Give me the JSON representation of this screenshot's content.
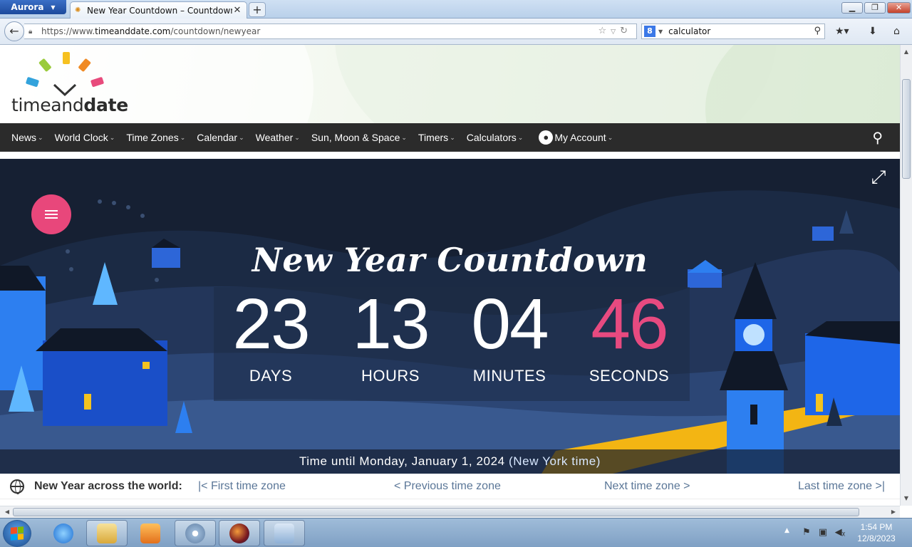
{
  "browser": {
    "app_name": "Aurora",
    "tab_title": "New Year Countdown – Countdown to ...",
    "new_tab_symbol": "+",
    "url_prefix": "https://www.",
    "url_domain": "timeanddate.com",
    "url_path": "/countdown/newyear",
    "search_value": "calculator",
    "search_engine_letter": "8"
  },
  "site": {
    "logo_text_light": "timeand",
    "logo_text_dark": "date",
    "nav": [
      {
        "label": "News"
      },
      {
        "label": "World Clock"
      },
      {
        "label": "Time Zones"
      },
      {
        "label": "Calendar"
      },
      {
        "label": "Weather"
      },
      {
        "label": "Sun, Moon & Space"
      },
      {
        "label": "Timers"
      },
      {
        "label": "Calculators"
      },
      {
        "label": "My Account"
      }
    ]
  },
  "countdown": {
    "title": "New Year Countdown",
    "days": "23",
    "days_label": "DAYS",
    "hours": "13",
    "hours_label": "HOURS",
    "minutes": "04",
    "minutes_label": "MINUTES",
    "seconds": "46",
    "seconds_label": "SECONDS",
    "until_text": "Time until Monday, January 1, 2024 ",
    "until_zone": "(New York time)"
  },
  "world_row": {
    "title": "New Year across the world:",
    "first": "First time zone",
    "previous": "Previous time zone",
    "next": "Next time zone",
    "last": "Last time zone"
  },
  "taskbar": {
    "time": "1:54 PM",
    "date": "12/8/2023"
  },
  "colors": {
    "accent_pink": "#e74a80",
    "nav_bg": "#2b2b2b",
    "hero_bg": "#162033",
    "link_blue": "#5a7697"
  },
  "icons": [
    "back-arrow-icon",
    "lock-icon",
    "star-icon",
    "reload-icon",
    "search-icon",
    "bookmarks-icon",
    "download-icon",
    "home-icon",
    "hamburger-icon",
    "fullscreen-icon",
    "globe-icon",
    "account-icon"
  ]
}
